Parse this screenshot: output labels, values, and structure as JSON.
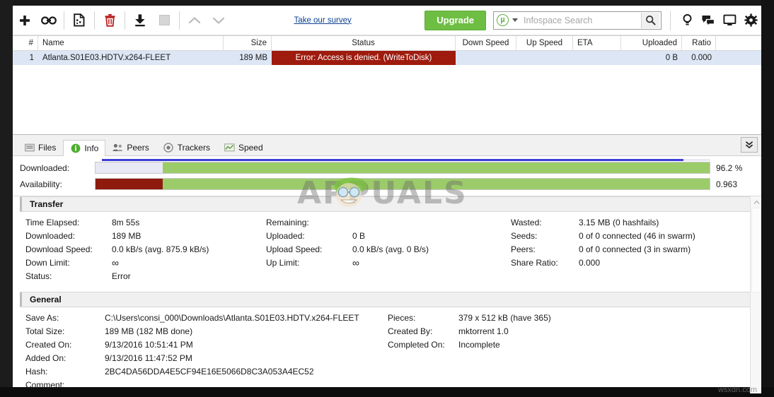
{
  "toolbar": {
    "buttons": [
      {
        "name": "add-torrent-button",
        "icon": "plus-icon",
        "label": "+"
      },
      {
        "name": "add-torrent-from-url-button",
        "icon": "link-icon",
        "label": ""
      },
      {
        "name": "create-torrent-button",
        "icon": "new-file-icon",
        "label": ""
      },
      {
        "name": "remove-torrent-button",
        "icon": "trash-icon",
        "label": ""
      },
      {
        "name": "start-torrent-button",
        "icon": "download-start-icon",
        "label": ""
      },
      {
        "name": "stop-torrent-button",
        "icon": "stop-square-icon",
        "label": ""
      },
      {
        "name": "move-up-button",
        "icon": "chevron-up-icon",
        "label": ""
      },
      {
        "name": "move-down-button",
        "icon": "chevron-down-icon",
        "label": ""
      }
    ],
    "survey_link": "Take our survey",
    "upgrade_label": "Upgrade",
    "search": {
      "placeholder": "Infospace Search",
      "value": "",
      "engine_icon": "utorrent-logo-icon",
      "go_icon": "search-icon"
    },
    "right_icons": [
      {
        "name": "lightbulb-icon"
      },
      {
        "name": "chat-bubbles-icon"
      },
      {
        "name": "monitor-icon"
      },
      {
        "name": "gear-icon"
      }
    ]
  },
  "list": {
    "columns": [
      {
        "key": "num",
        "label": "#"
      },
      {
        "key": "name",
        "label": "Name"
      },
      {
        "key": "size",
        "label": "Size"
      },
      {
        "key": "status",
        "label": "Status"
      },
      {
        "key": "down_speed",
        "label": "Down Speed"
      },
      {
        "key": "up_speed",
        "label": "Up Speed"
      },
      {
        "key": "eta",
        "label": "ETA"
      },
      {
        "key": "uploaded",
        "label": "Uploaded"
      },
      {
        "key": "ratio",
        "label": "Ratio"
      }
    ],
    "rows": [
      {
        "num": "1",
        "name": "Atlanta.S01E03.HDTV.x264-FLEET",
        "size": "189 MB",
        "status": "Error: Access is denied.  (WriteToDisk)",
        "status_color": "#9e1b0e",
        "down_speed": "",
        "up_speed": "",
        "eta": "",
        "uploaded": "0 B",
        "ratio": "0.000",
        "selected": true
      }
    ]
  },
  "detail": {
    "tabs": [
      {
        "label": "Files",
        "icon": "files-icon",
        "active": false
      },
      {
        "label": "Info",
        "icon": "info-icon",
        "active": true
      },
      {
        "label": "Peers",
        "icon": "peers-icon",
        "active": false
      },
      {
        "label": "Trackers",
        "icon": "trackers-icon",
        "active": false
      },
      {
        "label": "Speed",
        "icon": "speed-icon",
        "active": false
      }
    ],
    "collapse_icon": "double-chevron-down-icon",
    "progress": {
      "downloaded": {
        "label": "Downloaded:",
        "value": "96.2 %",
        "percent": 96.2,
        "lead_segment_percent": 11,
        "lead_color": "#e9e9f5",
        "fill_color": "#9bcc69"
      },
      "availability": {
        "label": "Availability:",
        "value": "0.963",
        "percent": 100,
        "lead_segment_percent": 11,
        "lead_color": "#8e1b0d",
        "fill_color": "#9bcc69"
      },
      "top_bar_color": "#3c3cd8"
    },
    "transfer": {
      "title": "Transfer",
      "col1": [
        {
          "key": "Time Elapsed:",
          "value": "8m 55s"
        },
        {
          "key": "Downloaded:",
          "value": "189 MB"
        },
        {
          "key": "Download Speed:",
          "value": "0.0 kB/s (avg. 875.9 kB/s)"
        },
        {
          "key": "Down Limit:",
          "value": "∞"
        },
        {
          "key": "Status:",
          "value": "Error"
        }
      ],
      "col2": [
        {
          "key": "Remaining:",
          "value": ""
        },
        {
          "key": "Uploaded:",
          "value": "0 B"
        },
        {
          "key": "Upload Speed:",
          "value": "0.0 kB/s (avg. 0 B/s)"
        },
        {
          "key": "Up Limit:",
          "value": "∞"
        }
      ],
      "col3": [
        {
          "key": "Wasted:",
          "value": "3.15 MB (0 hashfails)"
        },
        {
          "key": "Seeds:",
          "value": "0 of 0 connected (46 in swarm)"
        },
        {
          "key": "Peers:",
          "value": "0 of 0 connected (3 in swarm)"
        },
        {
          "key": "Share Ratio:",
          "value": "0.000"
        }
      ]
    },
    "general": {
      "title": "General",
      "col1": [
        {
          "key": "Save As:",
          "value": "C:\\Users\\consi_000\\Downloads\\Atlanta.S01E03.HDTV.x264-FLEET"
        },
        {
          "key": "Total Size:",
          "value": "189 MB (182 MB done)"
        },
        {
          "key": "Created On:",
          "value": "9/13/2016 10:51:41 PM"
        },
        {
          "key": "Added On:",
          "value": "9/13/2016 11:47:52 PM"
        },
        {
          "key": "Hash:",
          "value": "2BC4DA56DDA4E5CF94E16E5066D8C3A053A4EC52"
        },
        {
          "key": "Comment:",
          "value": ""
        }
      ],
      "col2": [
        {
          "key": "Pieces:",
          "value": "379 x 512 kB (have 365)"
        },
        {
          "key": "Created By:",
          "value": "mktorrent 1.0"
        },
        {
          "key": "Completed On:",
          "value": "Incomplete"
        }
      ]
    }
  },
  "watermarks": {
    "main": "APPUALS",
    "bottom": "wsxdn.com"
  },
  "colors": {
    "accent_green": "#6ebe44",
    "error_red": "#9e1b0e",
    "progress_green": "#9bcc69",
    "selection_blue": "#dce6f4",
    "link_blue": "#0b3f8f"
  }
}
